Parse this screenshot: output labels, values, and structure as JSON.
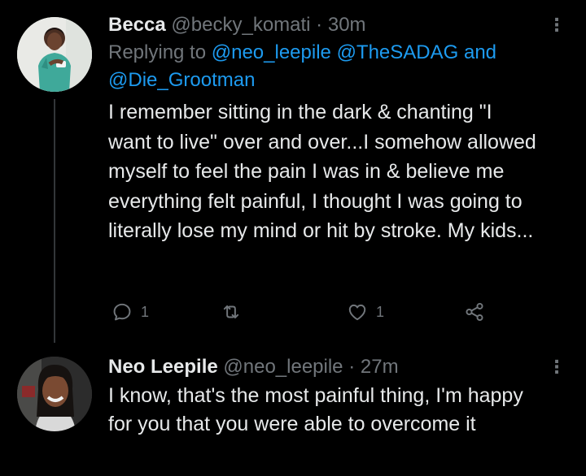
{
  "tweets": [
    {
      "name": "Becca",
      "handle": "@becky_komati",
      "separator": "·",
      "time": "30m",
      "replying_prefix": "Replying to",
      "replying_to": [
        "@neo_leepile",
        "@TheSADAG"
      ],
      "replying_joiner": "and",
      "replying_last": "@Die_Grootman",
      "body": "I remember sitting in the dark & chanting \"I want to live\" over and over...I somehow allowed myself to feel the pain I was in & believe me everything felt painful, I thought I was going to literally lose my mind or hit by stroke. My kids...",
      "reply_count": "1",
      "like_count": "1",
      "more_glyph": "⋮"
    },
    {
      "name": "Neo Leepile",
      "handle": "@neo_leepile",
      "separator": "·",
      "time": "27m",
      "body": "I know, that's the most painful thing, I'm happy for you that you were able to overcome it",
      "more_glyph": "⋮"
    }
  ],
  "icons": {
    "reply": "reply-icon",
    "retweet": "retweet-icon",
    "like": "heart-icon",
    "share": "share-icon",
    "more": "more-vertical-icon"
  },
  "colors": {
    "background": "#000000",
    "text": "#e7e9ea",
    "secondary": "#71767b",
    "link": "#1d9bf0",
    "thread_line": "#333639"
  }
}
